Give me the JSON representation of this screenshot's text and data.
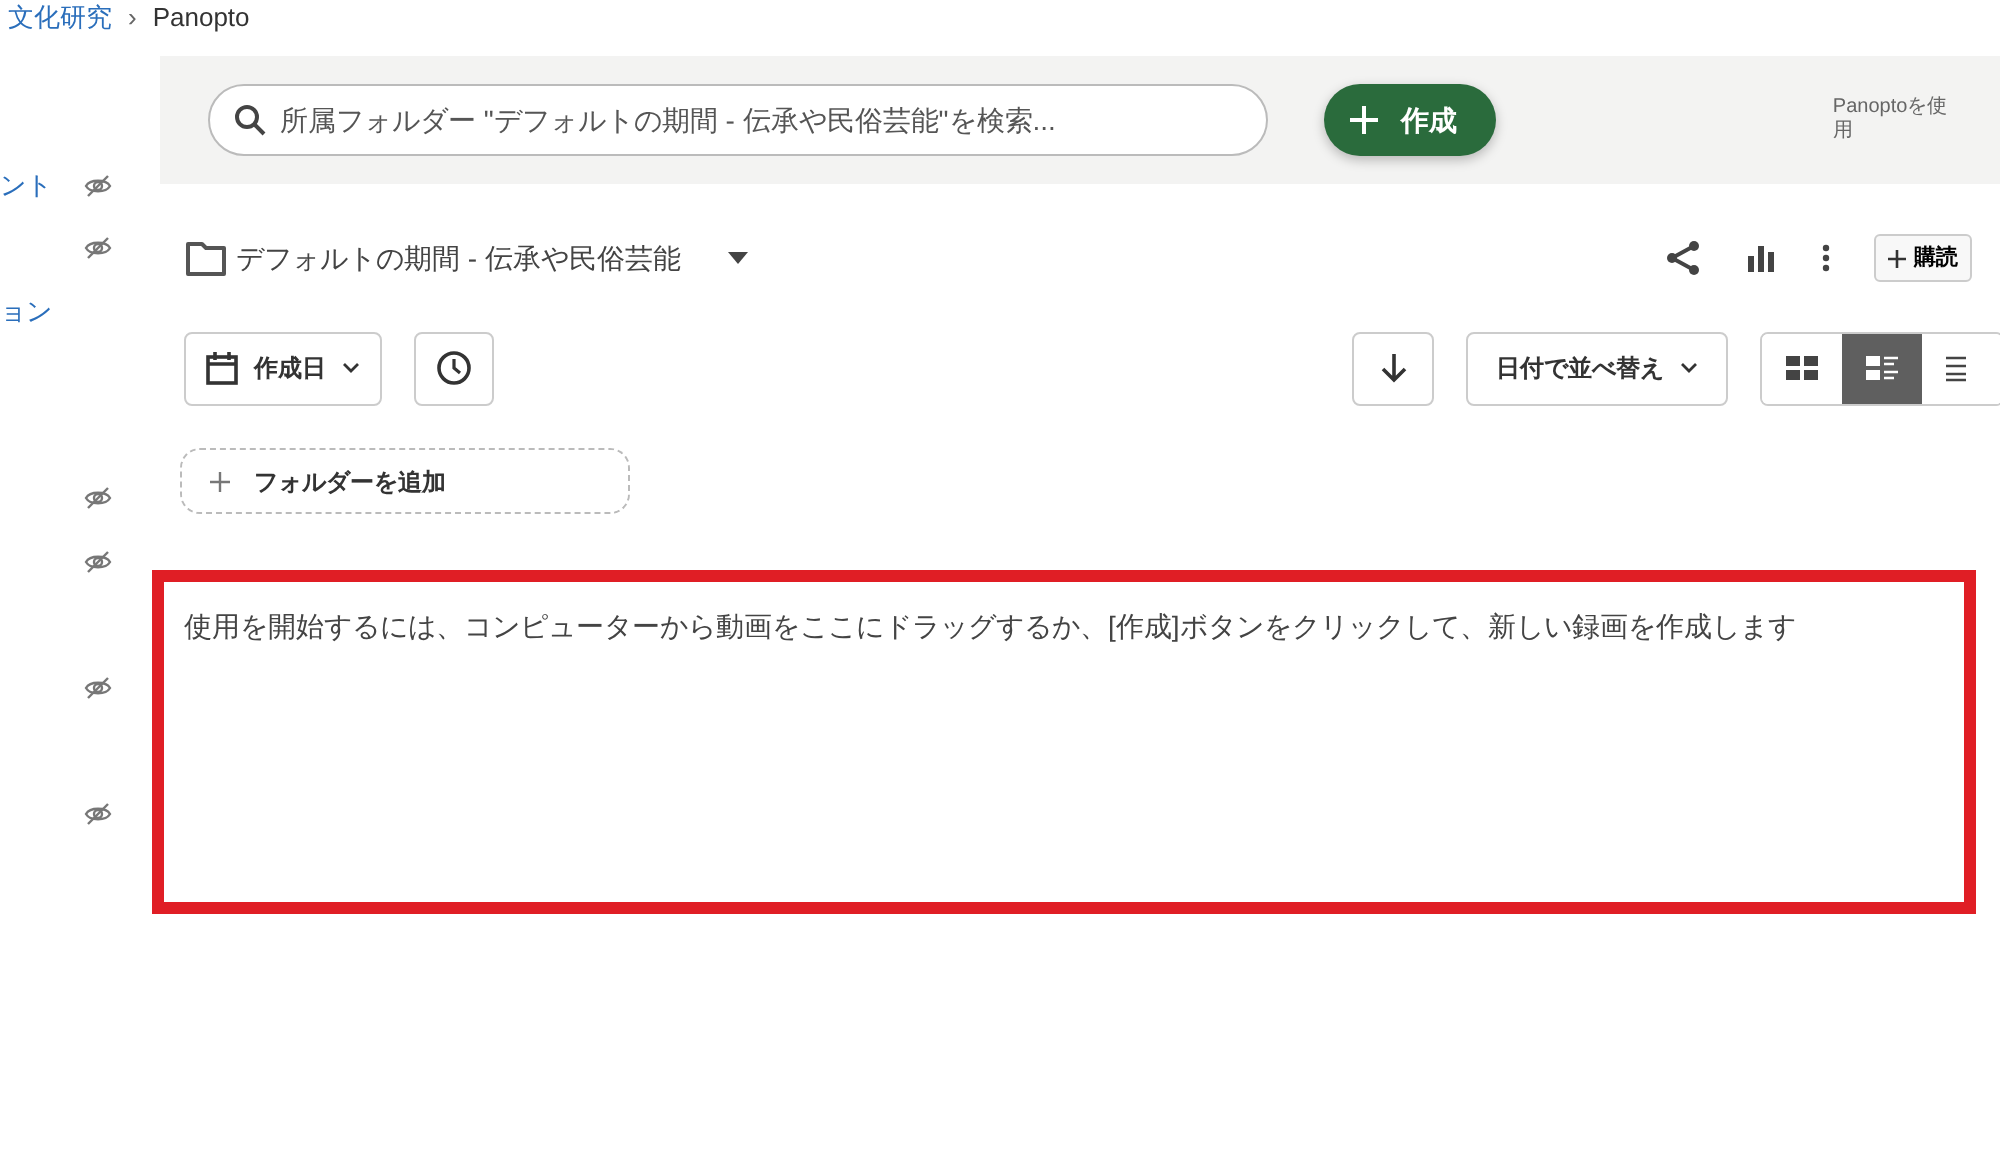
{
  "breadcrumb": {
    "items": [
      "文化研究",
      "Panopto"
    ],
    "separator": "›"
  },
  "sidebar": {
    "items": [
      {
        "label": "ント",
        "hidden": true
      },
      {
        "hidden": true
      },
      {
        "label": "ョン",
        "hidden": false
      },
      {
        "hidden": true
      },
      {
        "hidden": true
      },
      {
        "hidden": true
      },
      {
        "hidden": true
      }
    ]
  },
  "header": {
    "search": {
      "placeholder": "所属フォルダー \"デフォルトの期間 - 伝承や民俗芸能\"を検索..."
    },
    "create_button": "作成",
    "user_text": "Panoptoを使用"
  },
  "folder": {
    "title": "デフォルトの期間 - 伝承や民俗芸能",
    "subscribe_button": "購読"
  },
  "filters": {
    "date_button": "作成日",
    "sort_button": "日付で並べ替え"
  },
  "view_modes": [
    {
      "kind": "grid",
      "selected": false
    },
    {
      "kind": "detail",
      "selected": true
    },
    {
      "kind": "list",
      "selected": false
    }
  ],
  "add_folder_button": "フォルダーを追加",
  "empty_message": "使用を開始するには、コンピューターから動画をここにドラッグするか、[作成]ボタンをクリックして、新しい録画を作成します"
}
